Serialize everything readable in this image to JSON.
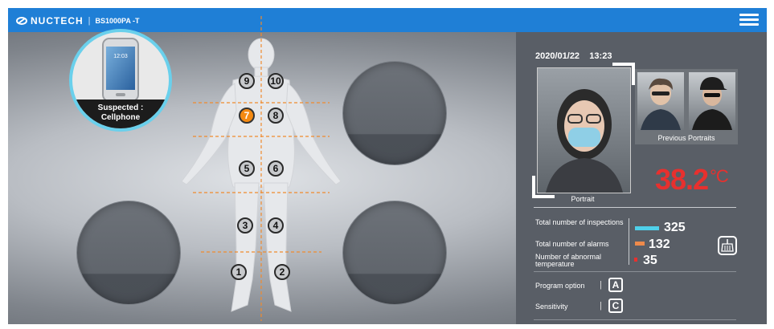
{
  "header": {
    "brand": "NUCTECH",
    "separator": "|",
    "model": "BS1000PA -T"
  },
  "scan": {
    "detected_item": "Cellphone",
    "suspected_line1": "Suspected :",
    "suspected_line2": "Cellphone",
    "phone_time": "12:03",
    "zones": [
      "1",
      "2",
      "3",
      "4",
      "5",
      "6",
      "7",
      "8",
      "9",
      "10"
    ],
    "alarm_zone": "7"
  },
  "panel": {
    "date": "2020/01/22",
    "time": "13:23",
    "portrait_label": "Portrait",
    "previous_label": "Previous Portraits",
    "temperature": "38.2",
    "temperature_unit": "°C",
    "stats": [
      {
        "label": "Total number of inspections",
        "value": "325",
        "color": "#4fd0ea"
      },
      {
        "label": "Total number of alarms",
        "value": "132",
        "color": "#ee8a4b"
      },
      {
        "label": "Number of abnormal temperature",
        "value": "35",
        "color": "#e8302e"
      }
    ],
    "program_option_label": "Program option",
    "program_option_value": "A",
    "sensitivity_label": "Sensitivity",
    "sensitivity_value": "C",
    "accent_color": "#1f7fd6"
  }
}
